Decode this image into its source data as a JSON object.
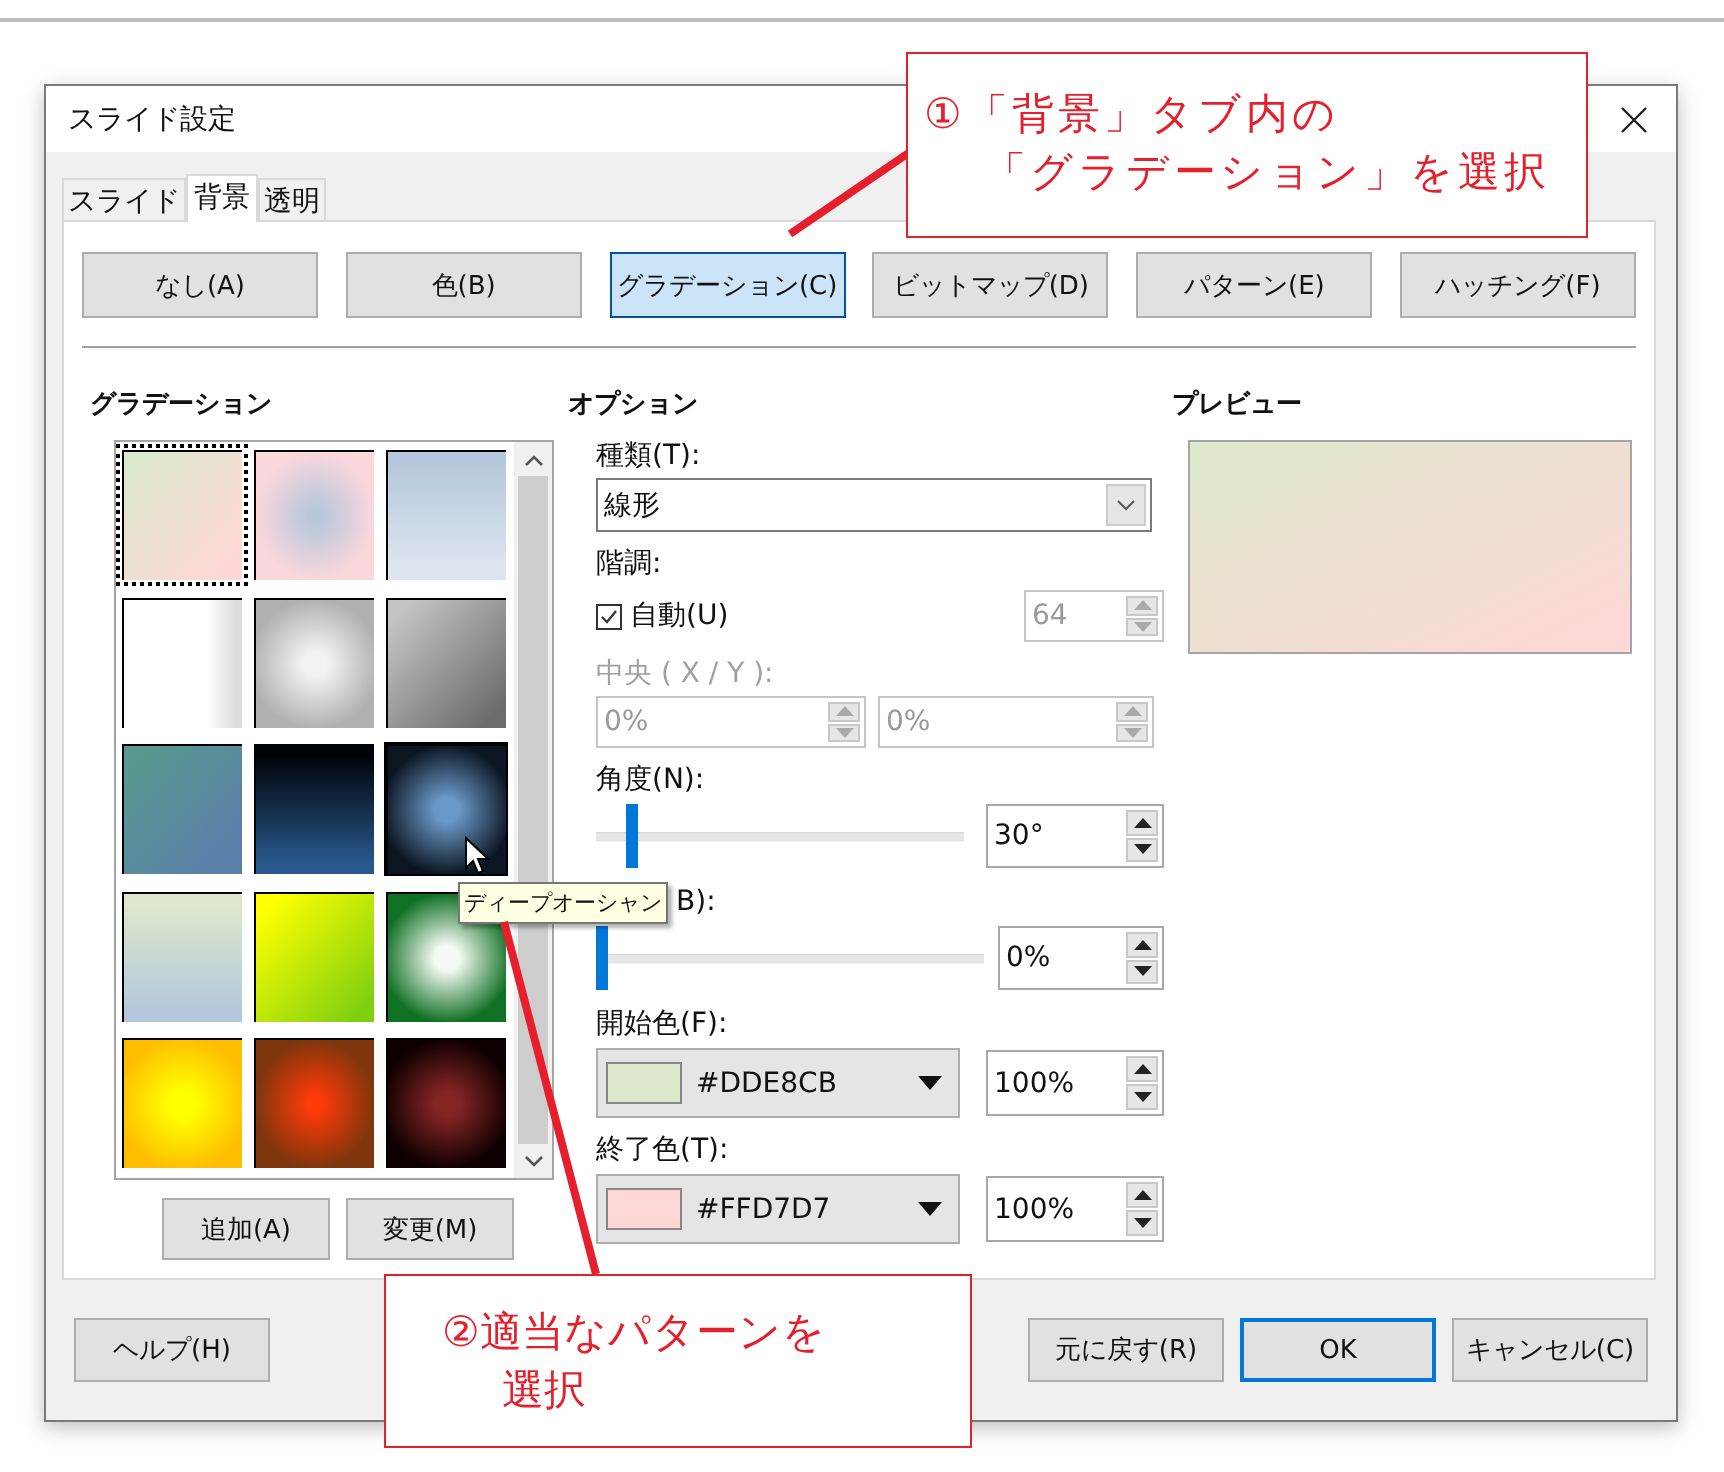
{
  "window": {
    "title": "スライド設定"
  },
  "tabs": [
    {
      "label": "スライド",
      "selected": false
    },
    {
      "label": "背景",
      "selected": true
    },
    {
      "label": "透明",
      "selected": false
    }
  ],
  "fill_buttons": [
    {
      "label": "なし(A)",
      "selected": false
    },
    {
      "label": "色(B)",
      "selected": false
    },
    {
      "label": "グラデーション(C)",
      "selected": true
    },
    {
      "label": "ビットマップ(D)",
      "selected": false
    },
    {
      "label": "パターン(E)",
      "selected": false
    },
    {
      "label": "ハッチング(F)",
      "selected": false
    }
  ],
  "gradients": {
    "heading": "グラデーション",
    "tooltip": "ディープオーシャン",
    "buttons": [
      "追加(A)",
      "変更(M)"
    ],
    "swatches": [
      {
        "kind": "diagonal",
        "stops": [
          {
            "color": "#dde8cb"
          },
          {
            "color": "#ffd7d7"
          }
        ],
        "selected": true,
        "hovered": false
      },
      {
        "kind": "square",
        "stops": [
          {
            "color": "#b8c8dc"
          },
          {
            "color": "#fad7dc"
          }
        ],
        "selected": false,
        "hovered": false
      },
      {
        "kind": "vertical",
        "stops": [
          {
            "color": "#b4c7dc"
          },
          {
            "color": "#dde6f0"
          }
        ],
        "selected": false,
        "hovered": false
      },
      {
        "kind": "horizontal",
        "stops": [
          {
            "color": "#ffffff"
          },
          {
            "color": "#dcdcdc"
          }
        ],
        "selected": false,
        "hovered": false
      },
      {
        "kind": "radial",
        "stops": [
          {
            "color": "#f2f2f2"
          },
          {
            "color": "#b0b0b0"
          }
        ],
        "selected": false,
        "hovered": false
      },
      {
        "kind": "diagonal",
        "stops": [
          {
            "color": "#c4c4c4"
          },
          {
            "color": "#6c6c6c"
          }
        ],
        "selected": false,
        "hovered": false
      },
      {
        "kind": "diagonal",
        "stops": [
          {
            "color": "#589890"
          },
          {
            "color": "#5a7eaa"
          }
        ],
        "selected": false,
        "hovered": false
      },
      {
        "kind": "vertical",
        "stops": [
          {
            "color": "#000408"
          },
          {
            "color": "#28588e"
          }
        ],
        "selected": false,
        "hovered": false
      },
      {
        "kind": "radial",
        "stops": [
          {
            "color": "#6a98c8"
          },
          {
            "color": "#0c1622"
          }
        ],
        "selected": false,
        "hovered": true
      },
      {
        "kind": "vertical",
        "stops": [
          {
            "color": "#dde8cb"
          },
          {
            "color": "#b4c8dc"
          }
        ],
        "selected": false,
        "hovered": false
      },
      {
        "kind": "diagonal",
        "stops": [
          {
            "color": "#ffff00"
          },
          {
            "color": "#80d010"
          }
        ],
        "selected": false,
        "hovered": false
      },
      {
        "kind": "radial",
        "stops": [
          {
            "color": "#f4fbf4"
          },
          {
            "color": "#107024"
          }
        ],
        "selected": false,
        "hovered": false
      },
      {
        "kind": "radial",
        "stops": [
          {
            "color": "#ffff00"
          },
          {
            "color": "#ffbf00"
          }
        ],
        "selected": false,
        "hovered": false
      },
      {
        "kind": "square",
        "stops": [
          {
            "color": "#ff3a08"
          },
          {
            "color": "#7f360c"
          }
        ],
        "selected": false,
        "hovered": false
      },
      {
        "kind": "radial",
        "stops": [
          {
            "color": "#862424"
          },
          {
            "color": "#0e0000"
          }
        ],
        "selected": false,
        "hovered": false
      }
    ]
  },
  "options": {
    "heading": "オプション",
    "type_label": "種類(T):",
    "type_value": "線形",
    "steps_label": "階調:",
    "auto": {
      "label": "自動(U)",
      "checked": true
    },
    "steps_value": {
      "value": "64",
      "disabled": true
    },
    "center_label": {
      "text": "中央 ( X / Y ):",
      "disabled": true
    },
    "center_x": {
      "value": "0%",
      "disabled": true
    },
    "center_y": {
      "value": "0%",
      "disabled": true
    },
    "angle_label": "角度(N):",
    "angle": {
      "level": 0.08
    },
    "angle_value": "30°",
    "border_label": "B):",
    "border": {
      "level": 0
    },
    "border_value": "0%",
    "start_label": "開始色(F):",
    "start_color": {
      "name": "#DDE8CB",
      "color": "#dde8cb"
    },
    "start_intensity": "100%",
    "end_label": "終了色(T):",
    "end_color": {
      "name": "#FFD7D7",
      "color": "#ffd7d7"
    },
    "end_intensity": "100%"
  },
  "preview": {
    "heading": "プレビュー"
  },
  "footer_buttons": [
    {
      "label": "ヘルプ(H)",
      "default": false
    },
    {
      "label": "元に戻す(R)",
      "default": false
    },
    {
      "label": "OK",
      "default": true
    },
    {
      "label": "キャンセル(C)",
      "default": false
    }
  ],
  "annotations": [
    {
      "lines": [
        "①「背景」タブ内の",
        "「グラデーション」を選択"
      ]
    },
    {
      "lines": [
        "②適当なパターンを",
        "選択"
      ]
    }
  ]
}
